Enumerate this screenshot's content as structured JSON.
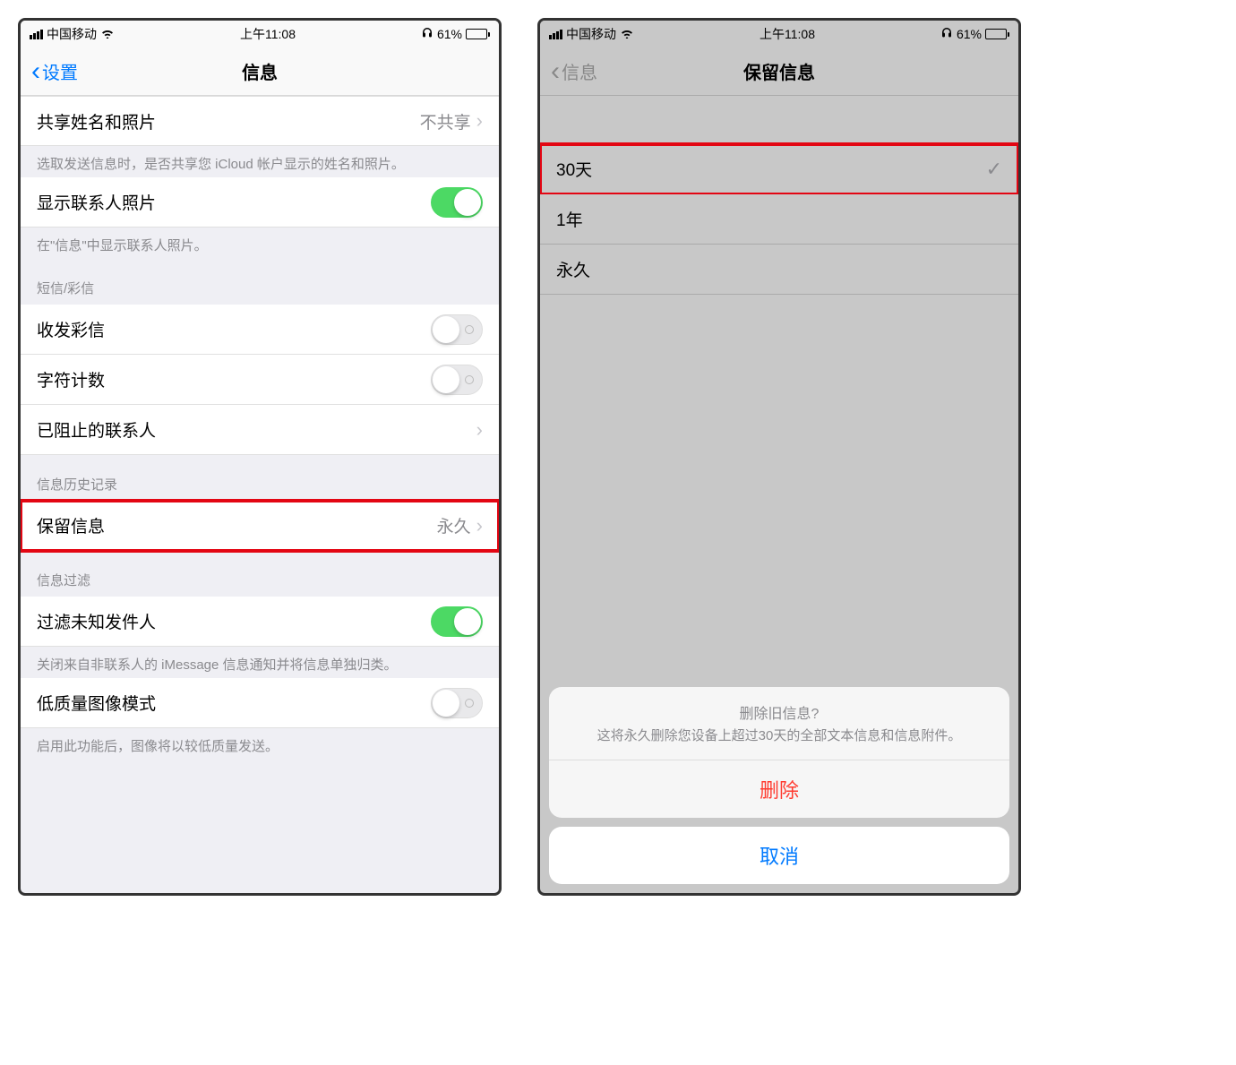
{
  "status": {
    "carrier": "中国移动",
    "time": "上午11:08",
    "battery": "61%"
  },
  "left": {
    "nav": {
      "back": "设置",
      "title": "信息"
    },
    "rows": {
      "share_name": {
        "label": "共享姓名和照片",
        "value": "不共享"
      },
      "share_name_footer": "选取发送信息时，是否共享您 iCloud 帐户显示的姓名和照片。",
      "show_contact_photo": {
        "label": "显示联系人照片"
      },
      "show_contact_photo_footer": "在\"信息\"中显示联系人照片。",
      "sms_header": "短信/彩信",
      "mms": {
        "label": "收发彩信"
      },
      "char_count": {
        "label": "字符计数"
      },
      "blocked": {
        "label": "已阻止的联系人"
      },
      "history_header": "信息历史记录",
      "keep": {
        "label": "保留信息",
        "value": "永久"
      },
      "filter_header": "信息过滤",
      "filter_unknown": {
        "label": "过滤未知发件人"
      },
      "filter_unknown_footer": "关闭来自非联系人的 iMessage 信息通知并将信息单独归类。",
      "low_quality": {
        "label": "低质量图像模式"
      },
      "low_quality_footer": "启用此功能后，图像将以较低质量发送。"
    }
  },
  "right": {
    "nav": {
      "back": "信息",
      "title": "保留信息"
    },
    "options": [
      {
        "label": "30天",
        "selected": true
      },
      {
        "label": "1年",
        "selected": false
      },
      {
        "label": "永久",
        "selected": false
      }
    ],
    "sheet": {
      "title": "删除旧信息?",
      "message": "这将永久删除您设备上超过30天的全部文本信息和信息附件。",
      "delete": "删除",
      "cancel": "取消"
    }
  }
}
